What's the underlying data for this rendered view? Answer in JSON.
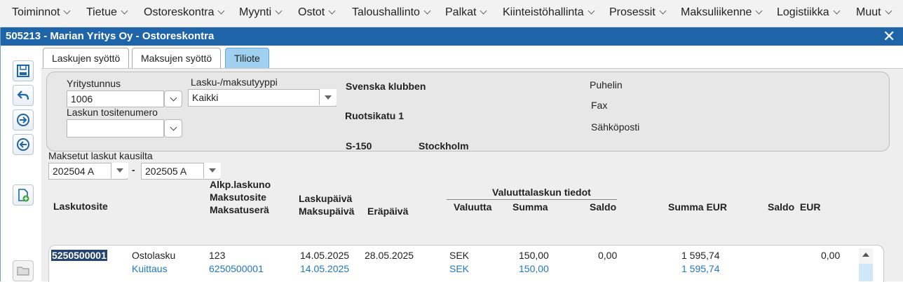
{
  "menu": [
    "Toiminnot",
    "Tietue",
    "Ostoreskontra",
    "Myynti",
    "Ostot",
    "Taloushallinto",
    "Palkat",
    "Kiinteistöhallinta",
    "Prosessit",
    "Maksuliikenne",
    "Logistiikka",
    "Muut"
  ],
  "window": {
    "title": "505213 - Marian Yritys Oy - Ostoreskontra",
    "close": "✕"
  },
  "tabs": [
    "Laskujen syöttö",
    "Maksujen syöttö",
    "Tiliote"
  ],
  "form": {
    "company_label": "Yritystunnus",
    "company_value": "1006",
    "type_label": "Lasku-/maksutyyppi",
    "type_value": "Kaikki",
    "voucher_label": "Laskun tositenumero",
    "voucher_value": "",
    "supplier_name": "Svenska klubben",
    "supplier_street": "Ruotsikatu 1",
    "supplier_zip": "S-150",
    "supplier_city": "Stockholm",
    "phone_label": "Puhelin",
    "fax_label": "Fax",
    "email_label": "Sähköposti"
  },
  "period": {
    "label": "Maksetut laskut kausilta",
    "from": "202504 A",
    "dash": "-",
    "to": "202505 A"
  },
  "columns": {
    "voucher": "Laskutosite",
    "orig_1": "Alkp.laskuno",
    "orig_2": "Maksutosite",
    "orig_3": "Maksatuserä",
    "date_1": "Laskupäivä",
    "date_2": "Maksupäivä",
    "due": "Eräpäivä",
    "currency_group": "Valuuttalaskun tiedot",
    "currency": "Valuutta",
    "sum": "Summa",
    "balance": "Saldo",
    "sum_eur_1": "Summa",
    "sum_eur_2": "EUR",
    "balance_eur_1": "Saldo",
    "balance_eur_2": "EUR"
  },
  "rows": [
    {
      "voucher": "5250500001",
      "type": "Ostolasku",
      "orig": "123",
      "date": "14.05.2025",
      "due": "28.05.2025",
      "currency": "SEK",
      "sum": "150,00",
      "balance": "0,00",
      "sum_eur": "1 595,74",
      "balance_eur": "0,00"
    },
    {
      "voucher": "",
      "type": "Kuittaus",
      "orig": "6250500001",
      "date": "14.05.2025",
      "due": "",
      "currency": "SEK",
      "sum": "150,00",
      "balance": "",
      "sum_eur": "1 595,74",
      "balance_eur": ""
    }
  ],
  "colors": {
    "titlebar": "#1e64a8",
    "active_tab": "#9fd0ef",
    "link": "#1f77c2",
    "selection": "#26456e"
  }
}
